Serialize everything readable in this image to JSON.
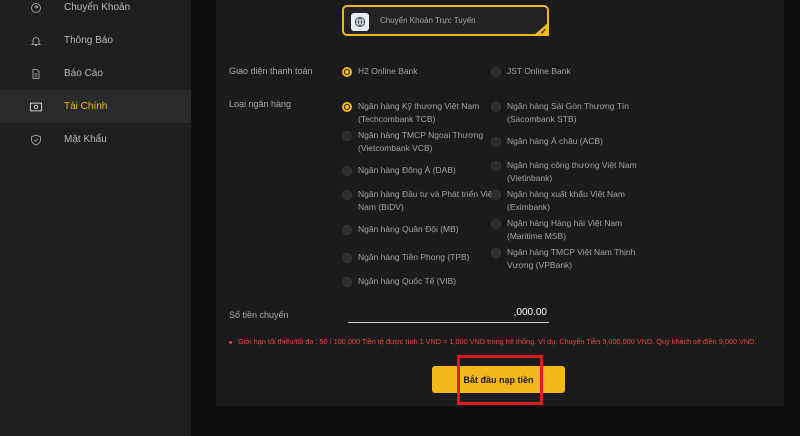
{
  "sidebar": {
    "items": [
      {
        "label": "Chuyển Khoản",
        "icon": "transfer-icon"
      },
      {
        "label": "Thông Báo",
        "icon": "bell-icon"
      },
      {
        "label": "Báo Cáo",
        "icon": "report-icon"
      },
      {
        "label": "Tài Chính",
        "icon": "finance-icon",
        "active": true
      },
      {
        "label": "Mật Khẩu",
        "icon": "shield-icon"
      }
    ]
  },
  "method": {
    "label": "Chuyển Khoản Trực Tuyến",
    "icon": "globe-icon",
    "selected": true
  },
  "payment_interface": {
    "label": "Giao diện thanh toán",
    "options": [
      {
        "label": "H2 Online Bank",
        "selected": true
      },
      {
        "label": "JST Online Bank",
        "selected": false
      }
    ]
  },
  "bank_type": {
    "label": "Loại ngân hàng",
    "left": [
      {
        "label": "Ngân hàng Kỹ thương Việt Nam (Techcombank TCB)",
        "selected": true
      },
      {
        "label": "Ngân hàng TMCP Ngoại Thương (Vietcombank VCB)",
        "selected": false
      },
      {
        "label": "Ngân hàng Đông Á (DAB)",
        "selected": false
      },
      {
        "label": "Ngân hàng Đầu tư và Phát triển Việt Nam (BIDV)",
        "selected": false
      },
      {
        "label": "Ngân hàng Quân Đội (MB)",
        "selected": false
      },
      {
        "label": "Ngân hàng Tiền Phong (TPB)",
        "selected": false
      },
      {
        "label": "Ngân hàng Quốc Tế (VIB)",
        "selected": false
      }
    ],
    "right": [
      {
        "label": "Ngân hàng Sài Gòn Thương Tín (Sacombank STB)",
        "selected": false
      },
      {
        "label": "Ngân hàng Á châu (ACB)",
        "selected": false
      },
      {
        "label": "Ngân hàng công thương Việt Nam (Vietinbank)",
        "selected": false
      },
      {
        "label": "Ngân hàng xuất khẩu Việt Nam (Eximbank)",
        "selected": false
      },
      {
        "label": "Ngân hàng Hàng hải Việt Nam (Maritime MSB)",
        "selected": false
      },
      {
        "label": "Ngân hàng TMCP Việt Nam Thịnh Vượng (VPBank)",
        "selected": false
      }
    ]
  },
  "amount": {
    "label": "Số tiền chuyển",
    "value": ",000.00"
  },
  "note": "Giới hạn tối thiểu/tối đa : 50 / 100,000 Tiền tệ được tính 1 VND = 1,000 VND trong hệ thống. Ví dụ: Chuyển Tiền 9,000,000 VND. Quý khách sẽ điền 9,000 VND.",
  "submit_label": "Bắt đầu nạp tiền",
  "colors": {
    "accent": "#f3b81d",
    "warning": "#e24b3b",
    "highlight": "#e01b1b"
  }
}
